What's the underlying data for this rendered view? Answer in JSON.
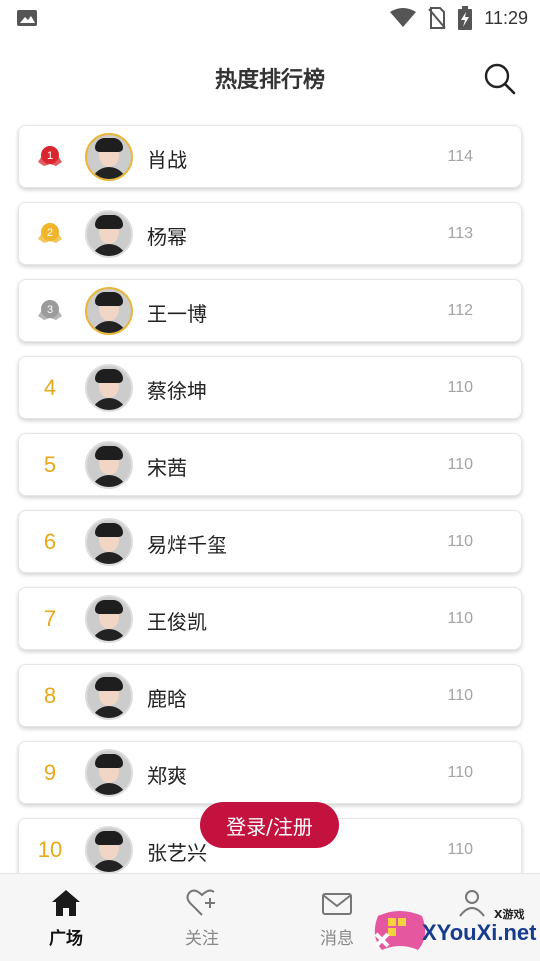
{
  "status_bar": {
    "time": "11:29",
    "icons": [
      "image-icon",
      "wifi-icon",
      "no-sim-icon",
      "battery-charging-icon"
    ]
  },
  "header": {
    "title": "热度排行榜",
    "search_icon": "search-icon"
  },
  "ranking": [
    {
      "rank": "1",
      "medal": "red",
      "name": "肖战",
      "score": "114",
      "avatar_border": "gold"
    },
    {
      "rank": "2",
      "medal": "gold",
      "name": "杨幂",
      "score": "113",
      "avatar_border": "plain"
    },
    {
      "rank": "3",
      "medal": "gray",
      "name": "王一博",
      "score": "112",
      "avatar_border": "gold"
    },
    {
      "rank": "4",
      "medal": "",
      "name": "蔡徐坤",
      "score": "110",
      "avatar_border": "plain"
    },
    {
      "rank": "5",
      "medal": "",
      "name": "宋茜",
      "score": "110",
      "avatar_border": "plain"
    },
    {
      "rank": "6",
      "medal": "",
      "name": "易烊千玺",
      "score": "110",
      "avatar_border": "plain"
    },
    {
      "rank": "7",
      "medal": "",
      "name": "王俊凯",
      "score": "110",
      "avatar_border": "plain"
    },
    {
      "rank": "8",
      "medal": "",
      "name": "鹿晗",
      "score": "110",
      "avatar_border": "plain"
    },
    {
      "rank": "9",
      "medal": "",
      "name": "郑爽",
      "score": "110",
      "avatar_border": "plain"
    },
    {
      "rank": "10",
      "medal": "",
      "name": "张艺兴",
      "score": "110",
      "avatar_border": "plain"
    }
  ],
  "login_button": {
    "label": "登录/注册",
    "color": "#c2123d"
  },
  "bottom_nav": [
    {
      "label": "广场",
      "icon": "home-icon",
      "active": true
    },
    {
      "label": "关注",
      "icon": "heart-plus-icon",
      "active": false
    },
    {
      "label": "消息",
      "icon": "mail-icon",
      "active": false
    },
    {
      "label": "",
      "icon": "profile-icon",
      "active": false
    }
  ],
  "watermark": {
    "brand": "XYouXi.net",
    "sub": "X游戏"
  },
  "colors": {
    "rank_number": "#e8a81b",
    "score": "#a3a3a3",
    "accent": "#c2123d"
  }
}
